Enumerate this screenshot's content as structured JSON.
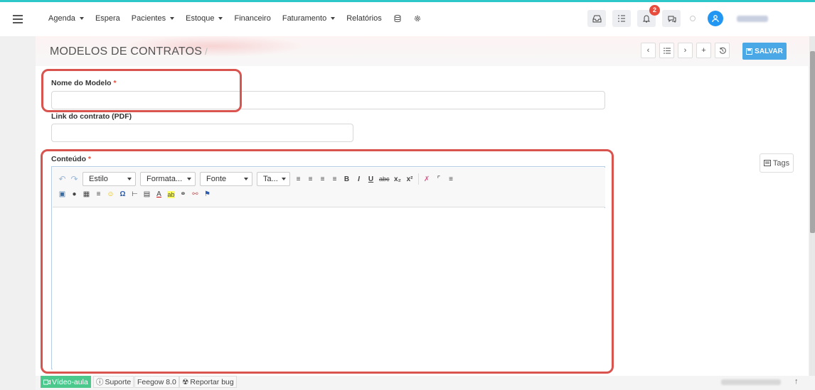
{
  "nav": {
    "menu": [
      {
        "label": "Agenda",
        "caret": true
      },
      {
        "label": "Espera",
        "caret": false
      },
      {
        "label": "Pacientes",
        "caret": true
      },
      {
        "label": "Estoque",
        "caret": true
      },
      {
        "label": "Financeiro",
        "caret": false
      },
      {
        "label": "Faturamento",
        "caret": true
      },
      {
        "label": "Relatórios",
        "caret": false
      }
    ],
    "notifications_count": "2"
  },
  "page": {
    "title": "MODELOS DE CONTRATOS",
    "title_slash": "/",
    "save_label": "SALVAR"
  },
  "form": {
    "model_name_label": "Nome do Modelo",
    "model_name_value": "",
    "required_mark": "*",
    "pdf_link_label": "Link do contrato (PDF)",
    "pdf_link_value": "",
    "content_label": "Conteúdo"
  },
  "editor": {
    "style_combo": "Estilo",
    "format_combo": "Formata...",
    "font_combo": "Fonte",
    "size_combo": "Ta..."
  },
  "tags_label": "Tags",
  "footer": {
    "video_label": "Vídeo-aula",
    "support_label": "Suporte",
    "version_label": "Feegow 8.0",
    "bug_label": "Reportar bug"
  },
  "colors": {
    "accent_top": "#2ec7c9",
    "save_button": "#4aa8e6",
    "highlight_box": "#d9534f",
    "badge": "#e74c3c",
    "video_button": "#4bc88c"
  }
}
